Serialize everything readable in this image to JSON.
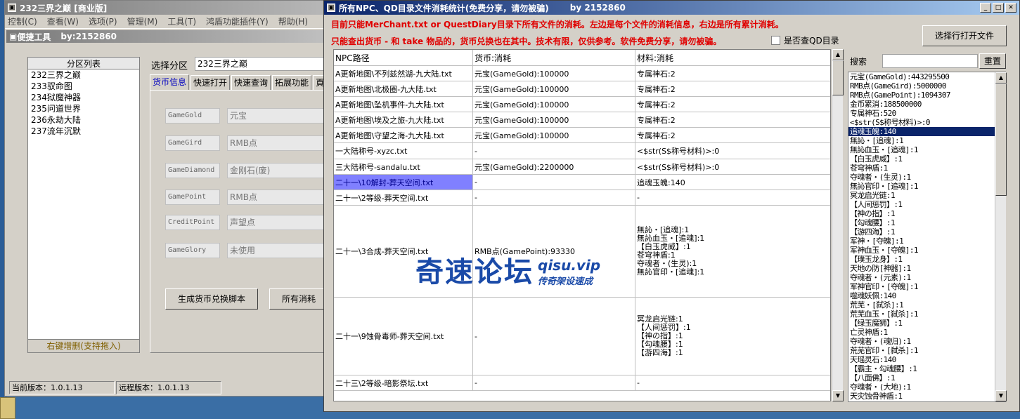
{
  "back_window": {
    "title": "232三界之巅 [商业版]",
    "menu": [
      "控制(C)",
      "查看(W)",
      "选项(P)",
      "管理(M)",
      "工具(T)",
      "鸿盾功能插件(Y)",
      "帮助(H)"
    ],
    "sub_title": "便捷工具",
    "sub_user": "by:2152860",
    "list_header": "分区列表",
    "list_items": [
      "232三界之巅",
      "233驭命图",
      "234狱魔神器",
      "235问道世界",
      "236永劫大陆",
      "237流年沉默"
    ],
    "list_footer": "右键增删(支持拖入)",
    "select_label": "选择分区",
    "select_value": "232三界之巅",
    "tabs": [
      "货币信息",
      "快速打开",
      "快速查询",
      "拓展功能",
      "頁"
    ],
    "fields": [
      {
        "name": "GameGold",
        "value": "元宝"
      },
      {
        "name": "GameGird",
        "value": "RMB点"
      },
      {
        "name": "GameDiamond",
        "value": "金刚石(废)"
      },
      {
        "name": "GamePoint",
        "value": "RMB点"
      },
      {
        "name": "CreditPoint",
        "value": "声望点"
      },
      {
        "name": "GameGlory",
        "value": "未使用"
      }
    ],
    "btn_generate": "生成货币兑换脚本",
    "btn_all": "所有消耗",
    "status_current": "当前版本：1.0.1.13",
    "status_remote": "远程版本：1.0.1.13"
  },
  "front_window": {
    "title": "所有NPC、QD目录文件消耗统计(免费分享，请勿被骗)",
    "title_by": "by 2152860",
    "info_line1": "目前只能MerChant.txt or QuestDiary目录下所有文件的消耗。左边是每个文件的消耗信息，右边是所有累计消耗。",
    "info_line2": "只能查出货币 - 和 take 物品的，货币兑换也在其中。技术有限，仅供参考。软件免费分享，请勿被骗。",
    "checkbox_label": "是否查QD目录",
    "btn_open": "选择行打开文件",
    "search_label": "搜索",
    "search_value": "",
    "btn_reset": "重置",
    "columns": [
      "NPC路径",
      "货币:消耗",
      "材料:消耗"
    ],
    "rows": [
      {
        "path": "A更新地图\\不列兹然湖-九大陆.txt",
        "currency": "元宝(GameGold):100000",
        "material": [
          "专属神石:2"
        ]
      },
      {
        "path": "A更新地图\\北极圈-九大陆.txt",
        "currency": "元宝(GameGold):100000",
        "material": [
          "专属神石:2"
        ]
      },
      {
        "path": "A更新地图\\坠机事件-九大陆.txt",
        "currency": "元宝(GameGold):100000",
        "material": [
          "专属神石:2"
        ]
      },
      {
        "path": "A更新地图\\埃及之旅-九大陆.txt",
        "currency": "元宝(GameGold):100000",
        "material": [
          "专属神石:2"
        ]
      },
      {
        "path": "A更新地图\\守望之海-九大陆.txt",
        "currency": "元宝(GameGold):100000",
        "material": [
          "专属神石:2"
        ]
      },
      {
        "path": "一大陆称号-xyzc.txt",
        "currency": "-",
        "material": [
          "<$str(S$称号材料)>:0"
        ]
      },
      {
        "path": "三大陆称号-sandalu.txt",
        "currency": "元宝(GameGold):2200000",
        "material": [
          "<$str(S$称号材料)>:0"
        ]
      },
      {
        "path": "二十一\\10解封-葬天空间.txt",
        "currency": "-",
        "material": [
          "追魂玉魄:140"
        ]
      },
      {
        "path": "二十一\\2等级-葬天空间.txt",
        "currency": "-",
        "material": [
          "-"
        ]
      },
      {
        "path": "二十一\\3合成-葬天空间.txt",
        "currency": "RMB点(GamePoint):93330",
        "material": [
          "無訫・[追魂]:1",
          "無訫血玉・[追魂]:1",
          "【白玉虎威】:1",
          "苍穹神盾:1",
          "夺魂者・(生灵):1",
          "無訫官印・[追魂]:1"
        ]
      },
      {
        "path": "二十一\\9蚀骨毒师-葬天空间.txt",
        "currency": "-",
        "material": [
          "冥龙启光链:1",
          "【人间惩罚】:1",
          "【神の指】:1",
          "【勾魂腰】:1",
          "【游四海】:1"
        ]
      },
      {
        "path": "二十三\\2等级-暗影祭坛.txt",
        "currency": "-",
        "material": [
          "-"
        ]
      }
    ],
    "totals": [
      "元宝(GameGold):443295500",
      "RMB点(GameGird):5000000",
      "RMB点(GamePoint):1094307",
      "金币累消:188500000",
      "专属神石:520",
      "<$str(S$称号材料)>:0",
      "追魂玉魄:140",
      "無訫・[追魂]:1",
      "無訫血玉・[追魂]:1",
      "【白玉虎威】:1",
      "苍穹神盾:1",
      "夺魂者・(生灵):1",
      "無訫官印・[追魂]:1",
      "冥龙启光链:1",
      "【人间惩罚】:1",
      "【神の指】:1",
      "【勾魂腰】:1",
      "【游四海】:1",
      "军神・[夺魄]:1",
      "军神血玉・[夺魄]:1",
      "【璞玉龙身】:1",
      "天地の防[神器]:1",
      "夺魂者・(元素):1",
      "军神官印・[夺魄]:1",
      "噬魂妖佩:140",
      "荒芜・[弑杀]:1",
      "荒芜血玉・[弑杀]:1",
      "【绿玉魔狮】:1",
      "亡灵神盾:1",
      "夺魂者・(魂归):1",
      "荒芜官印・[弑杀]:1",
      "天瑶灵石:140",
      "【霸主・勾魂腰】:1",
      "【八面佛】:1",
      "夺魂者・(大地):1",
      "天灾蚀骨神盾:1"
    ]
  },
  "watermark": {
    "main": "奇速论坛",
    "url": "qisu.vip",
    "sub": "传奇架设速成"
  }
}
